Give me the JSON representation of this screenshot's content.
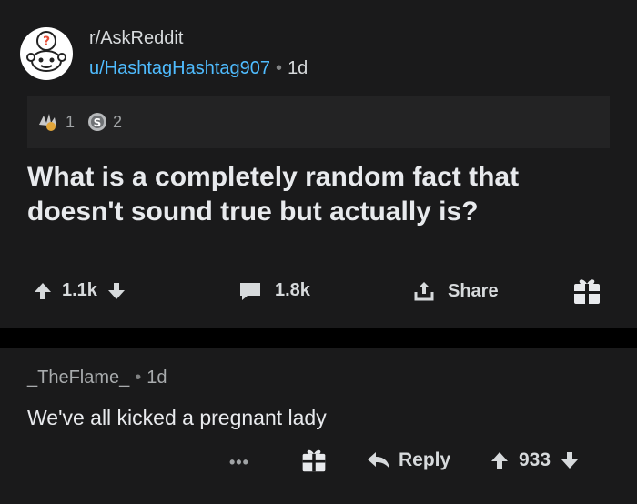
{
  "post": {
    "subreddit": "r/AskReddit",
    "author": "u/HashtagHashtag907",
    "separator": "•",
    "age": "1d",
    "awards": [
      {
        "icon": "helpful-award-icon",
        "count": "1"
      },
      {
        "icon": "silver-award-icon",
        "count": "2"
      }
    ],
    "title": "What is a completely random fact that doesn't sound true but actually is?",
    "upvotes": "1.1k",
    "comments": "1.8k",
    "share_label": "Share",
    "gift_icon": "gift-icon"
  },
  "comment": {
    "author": "_TheFlame_",
    "separator": "•",
    "age": "1d",
    "body": "We've all kicked a pregnant lady",
    "more": "•••",
    "reply_label": "Reply",
    "score": "933"
  },
  "colors": {
    "background": "#1a1a1b",
    "accent_link": "#4fbcff",
    "text": "#d7dadc"
  }
}
